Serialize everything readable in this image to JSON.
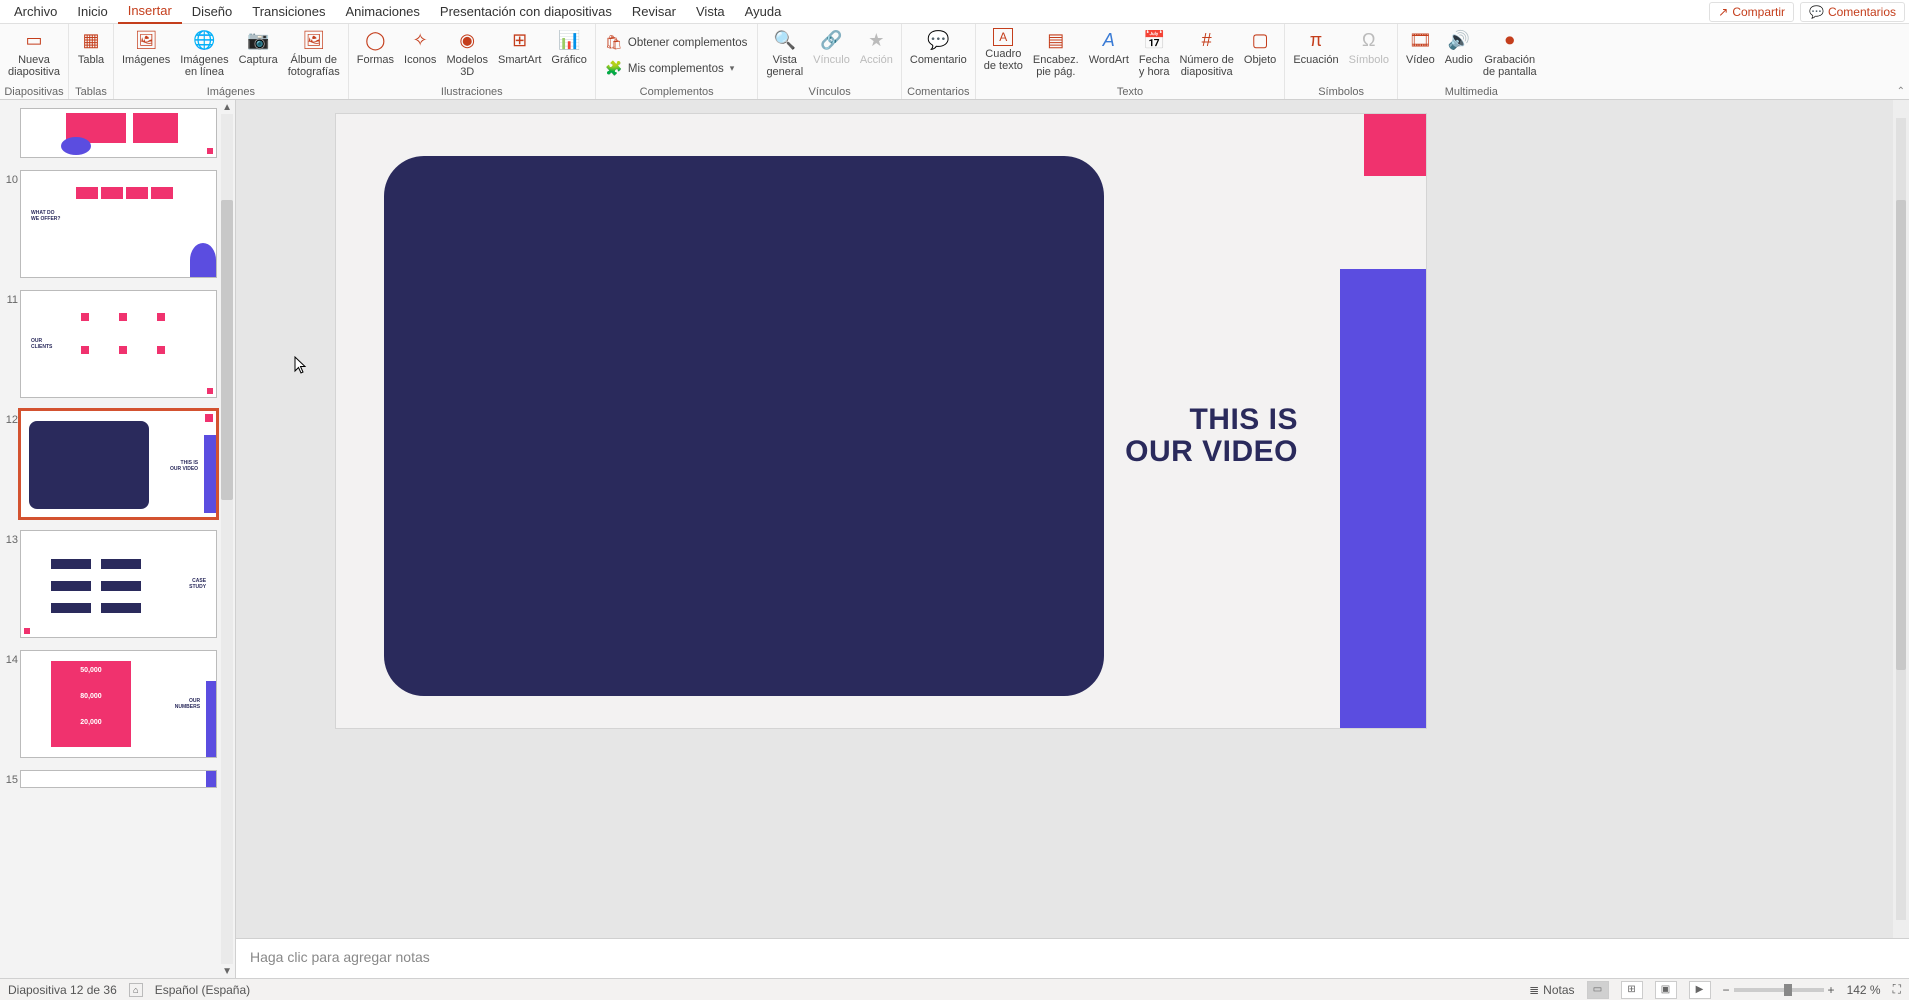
{
  "menu": {
    "items": [
      "Archivo",
      "Inicio",
      "Insertar",
      "Diseño",
      "Transiciones",
      "Animaciones",
      "Presentación con diapositivas",
      "Revisar",
      "Vista",
      "Ayuda"
    ],
    "active_index": 2,
    "share": "Compartir",
    "comments": "Comentarios"
  },
  "ribbon": {
    "groups": [
      {
        "label": "Diapositivas",
        "buttons": [
          {
            "name": "new-slide",
            "label": "Nueva\ndiapositiva",
            "dd": true
          }
        ]
      },
      {
        "label": "Tablas",
        "buttons": [
          {
            "name": "table",
            "label": "Tabla",
            "dd": true
          }
        ]
      },
      {
        "label": "Imágenes",
        "buttons": [
          {
            "name": "images",
            "label": "Imágenes"
          },
          {
            "name": "images-online",
            "label": "Imágenes\nen línea"
          },
          {
            "name": "screenshot",
            "label": "Captura",
            "dd": true
          },
          {
            "name": "photo-album",
            "label": "Álbum de\nfotografías",
            "dd": true
          }
        ]
      },
      {
        "label": "Ilustraciones",
        "buttons": [
          {
            "name": "shapes",
            "label": "Formas",
            "dd": true
          },
          {
            "name": "icons",
            "label": "Iconos"
          },
          {
            "name": "models-3d",
            "label": "Modelos\n3D",
            "dd": true
          },
          {
            "name": "smartart",
            "label": "SmartArt"
          },
          {
            "name": "chart",
            "label": "Gráfico"
          }
        ]
      },
      {
        "label": "Complementos",
        "small": [
          {
            "name": "get-addins",
            "label": "Obtener complementos"
          },
          {
            "name": "my-addins",
            "label": "Mis complementos",
            "dd": true
          }
        ]
      },
      {
        "label": "Vínculos",
        "buttons": [
          {
            "name": "zoom",
            "label": "Vista\ngeneral",
            "dd": true
          },
          {
            "name": "link",
            "label": "Vínculo",
            "disabled": true
          },
          {
            "name": "action",
            "label": "Acción",
            "disabled": true
          }
        ]
      },
      {
        "label": "Comentarios",
        "buttons": [
          {
            "name": "comment",
            "label": "Comentario"
          }
        ]
      },
      {
        "label": "Texto",
        "buttons": [
          {
            "name": "text-box",
            "label": "Cuadro\nde texto"
          },
          {
            "name": "header-footer",
            "label": "Encabez.\npie pág."
          },
          {
            "name": "wordart",
            "label": "WordArt",
            "dd": true
          },
          {
            "name": "date-time",
            "label": "Fecha\ny hora"
          },
          {
            "name": "slide-number",
            "label": "Número de\ndiapositiva"
          },
          {
            "name": "object",
            "label": "Objeto"
          }
        ]
      },
      {
        "label": "Símbolos",
        "buttons": [
          {
            "name": "equation",
            "label": "Ecuación",
            "dd": true
          },
          {
            "name": "symbol",
            "label": "Símbolo",
            "disabled": true
          }
        ]
      },
      {
        "label": "Multimedia",
        "buttons": [
          {
            "name": "video",
            "label": "Vídeo",
            "dd": true
          },
          {
            "name": "audio",
            "label": "Audio",
            "dd": true
          },
          {
            "name": "screen-record",
            "label": "Grabación\nde pantalla"
          }
        ]
      }
    ]
  },
  "thumbs": {
    "visible": [
      {
        "num": "",
        "partial": true
      },
      {
        "num": "10"
      },
      {
        "num": "11"
      },
      {
        "num": "12",
        "selected": true
      },
      {
        "num": "13"
      },
      {
        "num": "14"
      },
      {
        "num": "15",
        "tiny": true
      }
    ],
    "thumb12_title1": "THIS IS",
    "thumb12_title2": "OUR VIDEO"
  },
  "slide": {
    "title_line1": "THIS IS",
    "title_line2": "OUR VIDEO"
  },
  "notes": {
    "placeholder": "Haga clic para agregar notas"
  },
  "status": {
    "slide_counter": "Diapositiva 12 de 36",
    "language": "Español (España)",
    "notes_btn": "Notas",
    "zoom_pct": "142 %"
  },
  "colors": {
    "accent": "#c43e1c",
    "pink": "#f0326e",
    "purple": "#5b4de0",
    "navy": "#2a2a5c"
  }
}
